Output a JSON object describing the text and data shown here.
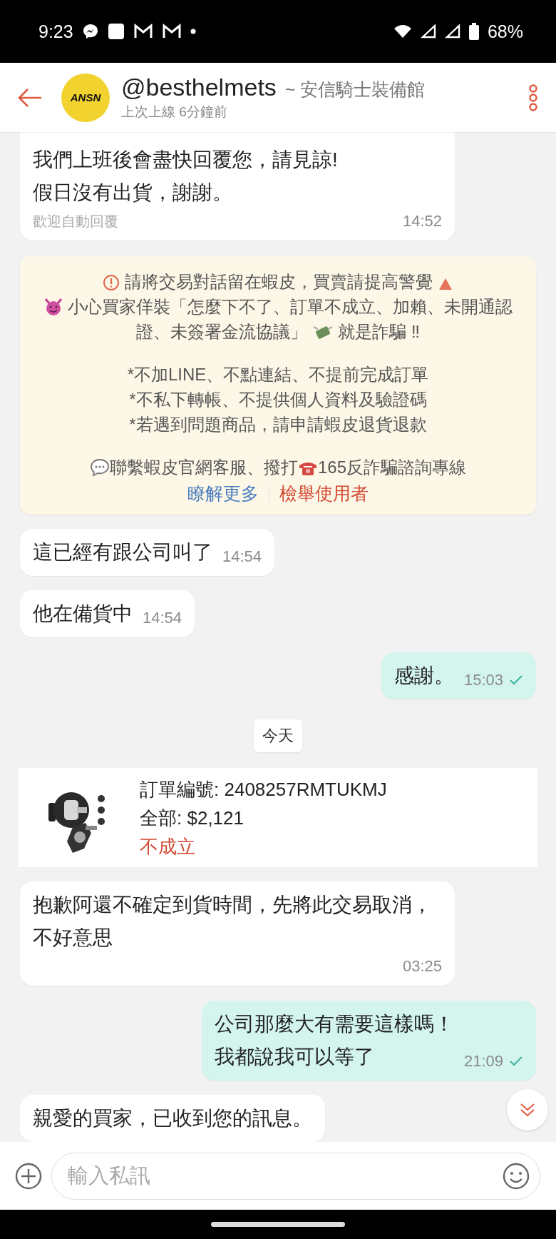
{
  "status_bar": {
    "time": "9:23",
    "battery": "68%"
  },
  "header": {
    "avatar_text": "ANSN",
    "username": "@besthelmets",
    "shop_name": "~ 安信騎士裝備館",
    "last_seen": "上次上線 6分鐘前"
  },
  "chat": [
    {
      "kind": "received",
      "lines": [
        "我們上班後會盡快回覆您，請見諒!",
        "假日沒有出貨，謝謝。"
      ],
      "caption": "歡迎自動回覆",
      "time": "14:52"
    },
    {
      "kind": "notice",
      "warning": [
        "請將交易對話留在蝦皮，買賣請提高警覺",
        "小心買家佯裝「怎麼下不了、訂單不成立、加賴、未開通認",
        "證、未簽署金流協議」",
        "就是詐騙 ‼"
      ],
      "tips": [
        "*不加LINE、不點連結、不提前完成訂單",
        "*不私下轉帳、不提供個人資料及驗證碼",
        "*若遇到問題商品，請申請蝦皮退貨退款"
      ],
      "contact": [
        "聯繫蝦皮官網客服、撥打",
        "165反詐騙諮詢專線"
      ],
      "links": [
        {
          "label": "瞭解更多",
          "color": "#4a7dbf"
        },
        {
          "label": "檢舉使用者",
          "color": "#d24a33"
        }
      ]
    },
    {
      "kind": "received",
      "lines": [
        "這已經有跟公司叫了"
      ],
      "time": "14:54"
    },
    {
      "kind": "received",
      "lines": [
        "他在備貨中"
      ],
      "time": "14:54"
    },
    {
      "kind": "sent",
      "lines": [
        "感謝。"
      ],
      "time": "15:03",
      "read": true
    },
    {
      "kind": "date",
      "label": "今天"
    },
    {
      "kind": "order",
      "order_no_label": "訂單編號:",
      "order_no": "2408257RMTUKMJ",
      "total_label": "全部:",
      "total": "$2,121",
      "status": "不成立"
    },
    {
      "kind": "received",
      "lines": [
        "抱歉阿還不確定到貨時間，先將此交易取消，不好意思"
      ],
      "time": "03:25"
    },
    {
      "kind": "sent",
      "lines": [
        "公司那麼大有需要這樣嗎！",
        "我都說我可以等了"
      ],
      "time": "21:09",
      "read": true
    },
    {
      "kind": "received",
      "lines": [
        "親愛的買家，已收到您的訊息。"
      ]
    }
  ],
  "composer": {
    "placeholder": "輸入私訊"
  }
}
